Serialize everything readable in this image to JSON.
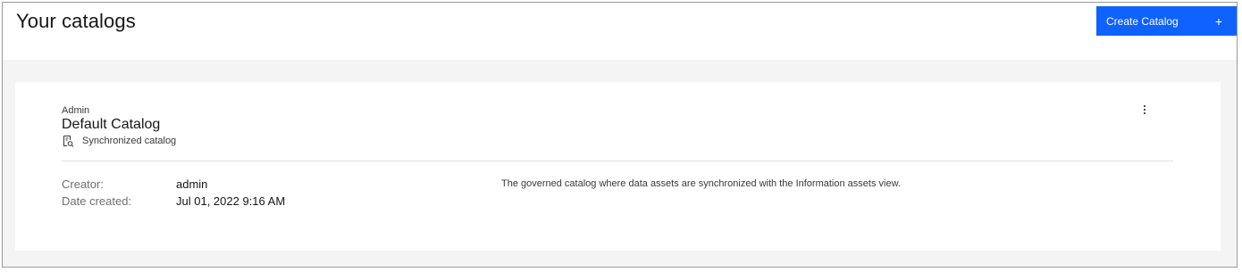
{
  "header": {
    "title": "Your catalogs",
    "create_button": {
      "label": "Create Catalog",
      "icon": "plus-icon",
      "symbol": "+"
    }
  },
  "catalog": {
    "owner": "Admin",
    "name": "Default Catalog",
    "type_label": "Synchronized catalog",
    "type_icon": "synchronized-catalog-icon",
    "overflow_icon": "overflow-menu-icon",
    "creator_label": "Creator:",
    "creator_value": "admin",
    "date_label": "Date created:",
    "date_value": "Jul 01, 2022 9:16 AM",
    "description": "The governed catalog where data assets are synchronized with the Information assets view."
  },
  "colors": {
    "accent": "#0f62fe",
    "background": "#f4f4f4",
    "card": "#ffffff"
  }
}
